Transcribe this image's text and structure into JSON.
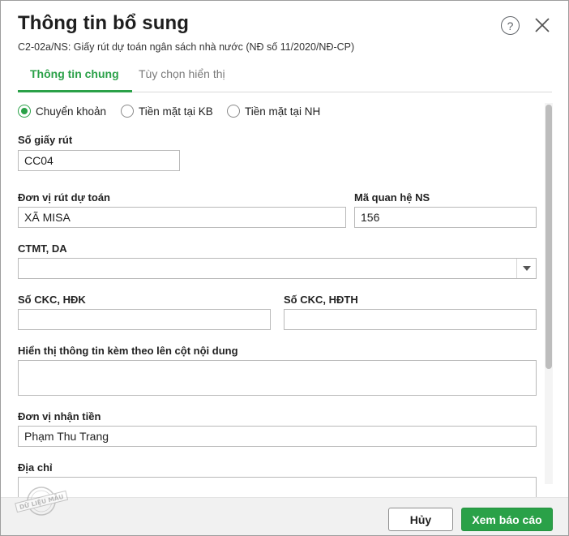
{
  "dialog": {
    "title": "Thông tin bổ sung",
    "subtitle": "C2-02a/NS: Giấy rút dự toán ngân sách nhà nước (NĐ số 11/2020/NĐ-CP)",
    "help_symbol": "?",
    "icons": {
      "help": "help-circle-icon",
      "close": "close-icon"
    }
  },
  "tabs": [
    {
      "label": "Thông tin chung",
      "active": true
    },
    {
      "label": "Tùy chọn hiển thị",
      "active": false
    }
  ],
  "payment_method": {
    "options": [
      "Chuyển khoản",
      "Tiền mặt tại KB",
      "Tiền mặt tại NH"
    ],
    "selected": "Chuyển khoản"
  },
  "form": {
    "so_giay_rut": {
      "label": "Số giấy rút",
      "value": "CC04"
    },
    "don_vi_rut_du_toan": {
      "label": "Đơn vị rút dự toán",
      "value": "XÃ MISA"
    },
    "ma_quan_he_ns": {
      "label": "Mã quan hệ NS",
      "value": "156"
    },
    "ctmt_da": {
      "label": "CTMT, DA",
      "value": ""
    },
    "so_ckc_hdk": {
      "label": "Số CKC, HĐK",
      "value": ""
    },
    "so_ckc_hdth": {
      "label": "Số CKC, HĐTH",
      "value": ""
    },
    "hien_thi_thong_tin": {
      "label": "Hiển thị thông tin kèm theo lên cột nội dung",
      "value": ""
    },
    "don_vi_nhan_tien": {
      "label": "Đơn vị nhận tiền",
      "value": "Phạm Thu Trang"
    },
    "dia_chi": {
      "label": "Địa chỉ",
      "value": ""
    }
  },
  "footer": {
    "cancel_label": "Hủy",
    "view_report_label": "Xem báo cáo"
  },
  "watermark": "DỮ LIỆU MẪU",
  "colors": {
    "accent": "#2aa148"
  }
}
